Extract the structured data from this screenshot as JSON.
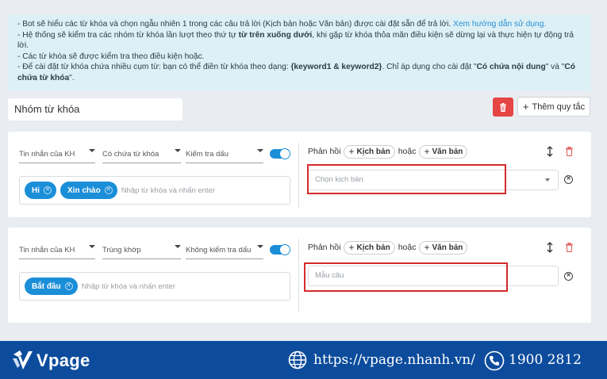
{
  "info": {
    "line1_pre": "- Bot sẽ hiểu các từ khóa và chọn ngẫu nhiên 1 trong các câu trả lời (Kịch bản hoặc Văn bản) được cài đặt sẵn để trả lời.",
    "line1_link": "Xem hướng dẫn sử dụng.",
    "line2_pre": "- Hệ thống sẽ kiểm tra các nhóm từ khóa lần lượt theo thứ tự",
    "line2_bold": "từ trên xuống dưới",
    "line2_post": ", khi gặp từ khóa thỏa mãn điều kiện sẽ dừng lại và thực hiện tự động trả lời.",
    "line3": "- Các từ khóa sẽ được kiểm tra theo điều kiện hoặc.",
    "line4_pre": "- Để cài đặt từ khóa chứa nhiều cụm từ: bạn có thể điền từ khóa theo dạng:",
    "line4_bold1": "{keyword1 & keyword2}",
    "line4_mid": ". Chỉ áp dụng cho cài đặt \"",
    "line4_bold2": "Có chứa nội dung",
    "line4_and": "\" và \"",
    "line4_bold3": "Có chứa từ khóa",
    "line4_end": "\"."
  },
  "group_name": "Nhóm từ khóa",
  "add_rule_label": "Thêm quy tắc",
  "rules": [
    {
      "source": "Tin nhắn của KH",
      "match": "Có chứa từ khóa",
      "accent": "Kiểm tra dấu",
      "enabled": true,
      "keywords": [
        "Hi",
        "Xin chào"
      ],
      "keyword_placeholder": "Nhập từ khóa và nhấn enter",
      "response_label": "Phản hồi",
      "script_label": "Kịch bản",
      "or_label": "hoặc",
      "text_label": "Văn bản",
      "script_placeholder": "Chọn kịch bản"
    },
    {
      "source": "Tin nhắn của KH",
      "match": "Trùng khớp",
      "accent": "Không kiểm tra dấu",
      "enabled": true,
      "keywords": [
        "Bắt đầu"
      ],
      "keyword_placeholder": "Nhập từ khóa và nhấn enter",
      "response_label": "Phản hồi",
      "script_label": "Kịch bản",
      "or_label": "hoặc",
      "text_label": "Văn bản",
      "text_placeholder": "Mẫu câu"
    }
  ],
  "footer": {
    "brand": "Vpage",
    "url": "https://vpage.nhanh.vn/",
    "phone": "1900 2812"
  },
  "colors": {
    "primary": "#1b8ed8",
    "danger": "#e54545",
    "footer_bg": "#0d4c9c",
    "highlight": "#d42b2b"
  }
}
